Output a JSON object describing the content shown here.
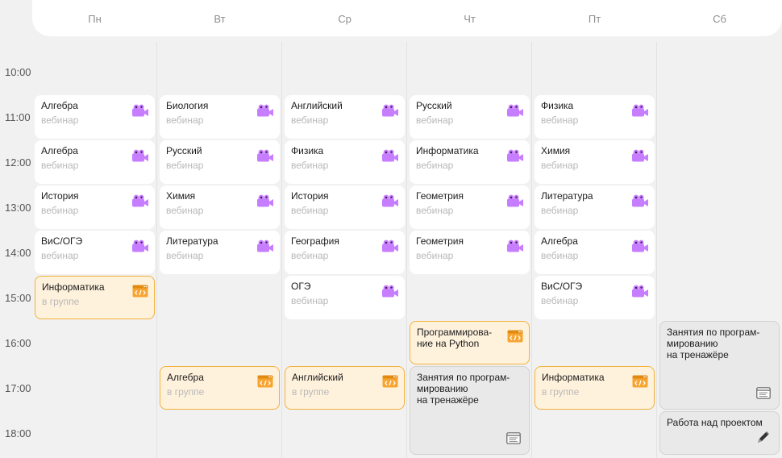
{
  "days": [
    "Пн",
    "Вт",
    "Ср",
    "Чт",
    "Пт",
    "Сб"
  ],
  "times": [
    "10:00",
    "11:00",
    "12:00",
    "13:00",
    "14:00",
    "15:00",
    "16:00",
    "17:00",
    "18:00"
  ],
  "events": [
    {
      "day": 0,
      "slot": 1,
      "span": 1,
      "type": "webinar",
      "title": "Алгебра",
      "subtitle": "вебинар"
    },
    {
      "day": 0,
      "slot": 2,
      "span": 1,
      "type": "webinar",
      "title": "Алгебра",
      "subtitle": "вебинар"
    },
    {
      "day": 0,
      "slot": 3,
      "span": 1,
      "type": "webinar",
      "title": "История",
      "subtitle": "вебинар"
    },
    {
      "day": 0,
      "slot": 4,
      "span": 1,
      "type": "webinar",
      "title": "ВиС/ОГЭ",
      "subtitle": "вебинар"
    },
    {
      "day": 0,
      "slot": 5,
      "span": 1,
      "type": "group",
      "title": "Информатика",
      "subtitle": "в группе"
    },
    {
      "day": 1,
      "slot": 1,
      "span": 1,
      "type": "webinar",
      "title": "Биология",
      "subtitle": "вебинар"
    },
    {
      "day": 1,
      "slot": 2,
      "span": 1,
      "type": "webinar",
      "title": "Русский",
      "subtitle": "вебинар"
    },
    {
      "day": 1,
      "slot": 3,
      "span": 1,
      "type": "webinar",
      "title": "Химия",
      "subtitle": "вебинар"
    },
    {
      "day": 1,
      "slot": 4,
      "span": 1,
      "type": "webinar",
      "title": "Литература",
      "subtitle": "вебинар"
    },
    {
      "day": 1,
      "slot": 7,
      "span": 1,
      "type": "group",
      "title": "Алгебра",
      "subtitle": "в группе"
    },
    {
      "day": 2,
      "slot": 1,
      "span": 1,
      "type": "webinar",
      "title": "Английский",
      "subtitle": "вебинар"
    },
    {
      "day": 2,
      "slot": 2,
      "span": 1,
      "type": "webinar",
      "title": "Физика",
      "subtitle": "вебинар"
    },
    {
      "day": 2,
      "slot": 3,
      "span": 1,
      "type": "webinar",
      "title": "История",
      "subtitle": "вебинар"
    },
    {
      "day": 2,
      "slot": 4,
      "span": 1,
      "type": "webinar",
      "title": "География",
      "subtitle": "вебинар"
    },
    {
      "day": 2,
      "slot": 5,
      "span": 1,
      "type": "webinar",
      "title": "ОГЭ",
      "subtitle": "вебинар"
    },
    {
      "day": 2,
      "slot": 7,
      "span": 1,
      "type": "group",
      "title": "Английский",
      "subtitle": "в группе"
    },
    {
      "day": 3,
      "slot": 1,
      "span": 1,
      "type": "webinar",
      "title": "Русский",
      "subtitle": "вебинар"
    },
    {
      "day": 3,
      "slot": 2,
      "span": 1,
      "type": "webinar",
      "title": "Информатика",
      "subtitle": "вебинар"
    },
    {
      "day": 3,
      "slot": 3,
      "span": 1,
      "type": "webinar",
      "title": "Геометрия",
      "subtitle": "вебинар"
    },
    {
      "day": 3,
      "slot": 4,
      "span": 1,
      "type": "webinar",
      "title": "Геометрия",
      "subtitle": "вебинар"
    },
    {
      "day": 3,
      "slot": 6,
      "span": 1,
      "type": "group",
      "title": "Программирова-\nние на Python",
      "subtitle": ""
    },
    {
      "day": 3,
      "slot": 7,
      "span": 2,
      "type": "trainer",
      "title": "Занятия по програм-\nмированию\nна тренажёре",
      "subtitle": ""
    },
    {
      "day": 4,
      "slot": 1,
      "span": 1,
      "type": "webinar",
      "title": "Физика",
      "subtitle": "вебинар"
    },
    {
      "day": 4,
      "slot": 2,
      "span": 1,
      "type": "webinar",
      "title": "Химия",
      "subtitle": "вебинар"
    },
    {
      "day": 4,
      "slot": 3,
      "span": 1,
      "type": "webinar",
      "title": "Литература",
      "subtitle": "вебинар"
    },
    {
      "day": 4,
      "slot": 4,
      "span": 1,
      "type": "webinar",
      "title": "Алгебра",
      "subtitle": "вебинар"
    },
    {
      "day": 4,
      "slot": 5,
      "span": 1,
      "type": "webinar",
      "title": "ВиС/ОГЭ",
      "subtitle": "вебинар"
    },
    {
      "day": 4,
      "slot": 7,
      "span": 1,
      "type": "group",
      "title": "Информатика",
      "subtitle": "в группе"
    },
    {
      "day": 5,
      "slot": 6,
      "span": 2,
      "type": "trainer",
      "title": "Занятия по програм-\nмированию\nна тренажёре",
      "subtitle": ""
    },
    {
      "day": 5,
      "slot": 8,
      "span": 1,
      "type": "project",
      "title": "Работа над проектом",
      "subtitle": ""
    }
  ],
  "colors": {
    "webinar_icon": "#c77dff",
    "group_icon": "#f7a531",
    "group_border": "#f3b13d",
    "group_bg": "#fff2dd"
  }
}
